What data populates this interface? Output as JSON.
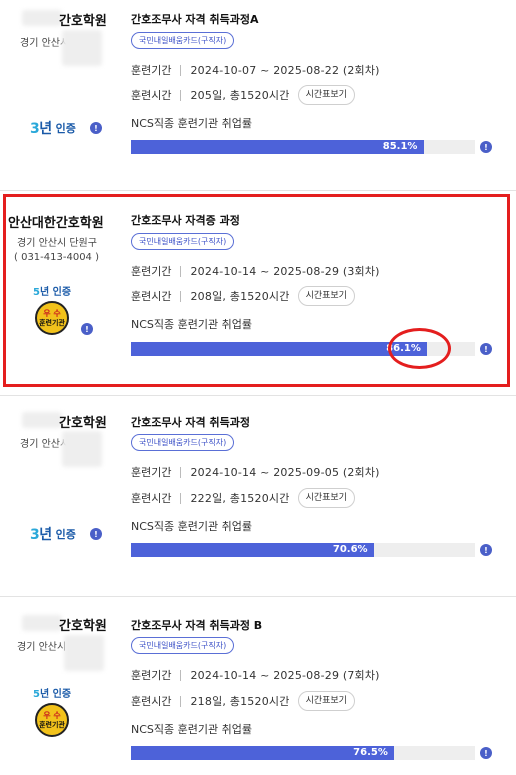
{
  "listings": [
    {
      "school_name": "간호학원",
      "address": "경기 안산시",
      "phone": "",
      "cert": {
        "years_num": "3",
        "years_unit": "년",
        "label": "인증",
        "excellent_badge": false
      },
      "course_title": "간호조무사 자격 취득과정A",
      "tag": "국민내일배움카드(구직자)",
      "period_label": "훈련기간",
      "period_value": "2024-10-07 ~ 2025-08-22 (2회차)",
      "hours_label": "훈련시간",
      "hours_value": "205일, 총1520시간",
      "timetable_button": "시간표보기",
      "ncs_label": "NCS직종 훈련기관 취업률",
      "employment_rate_text": "85.1%",
      "employment_rate": 85.1
    },
    {
      "school_name": "안산대한간호학원",
      "address": "경기 안산시 단원구",
      "phone": "( 031-413-4004 )",
      "cert": {
        "years_num": "5",
        "years_unit": "년",
        "label": "인증",
        "excellent_badge": true,
        "badge_top": "우 수",
        "badge_bottom": "훈련기관"
      },
      "course_title": "간호조무사 자격증 과정",
      "tag": "국민내일배움카드(구직자)",
      "period_label": "훈련기간",
      "period_value": "2024-10-14 ~ 2025-08-29 (3회차)",
      "hours_label": "훈련시간",
      "hours_value": "208일, 총1520시간",
      "timetable_button": "시간표보기",
      "ncs_label": "NCS직종 훈련기관 취업률",
      "employment_rate_text": "86.1%",
      "employment_rate": 86.1
    },
    {
      "school_name": "간호학원",
      "address": "경기 안산시",
      "phone": "",
      "cert": {
        "years_num": "3",
        "years_unit": "년",
        "label": "인증",
        "excellent_badge": false
      },
      "course_title": "간호조무사 자격 취득과정",
      "tag": "국민내일배움카드(구직자)",
      "period_label": "훈련기간",
      "period_value": "2024-10-14 ~ 2025-09-05 (2회차)",
      "hours_label": "훈련시간",
      "hours_value": "222일, 총1520시간",
      "timetable_button": "시간표보기",
      "ncs_label": "NCS직종 훈련기관 취업률",
      "employment_rate_text": "70.6%",
      "employment_rate": 70.6
    },
    {
      "school_name": "간호학원",
      "address": "경기 안산시",
      "phone": "",
      "cert": {
        "years_num": "5",
        "years_unit": "년",
        "label": "인증",
        "excellent_badge": true,
        "badge_top": "우 수",
        "badge_bottom": "훈련기관"
      },
      "course_title": "간호조무사 자격 취득과정 B",
      "tag": "국민내일배움카드(구직자)",
      "period_label": "훈련기간",
      "period_value": "2024-10-14 ~ 2025-08-29 (7회차)",
      "hours_label": "훈련시간",
      "hours_value": "218일, 총1520시간",
      "timetable_button": "시간표보기",
      "ncs_label": "NCS직종 훈련기관 취업률",
      "employment_rate_text": "76.5%",
      "employment_rate": 76.5
    }
  ],
  "info_icon_glyph": "!",
  "colors": {
    "bar_fill": "#4d62d9",
    "bar_track": "#eeeeee",
    "tag_border": "#5a6fd6",
    "highlight": "#e41e1e",
    "badge_gold": "#f2c21b"
  }
}
